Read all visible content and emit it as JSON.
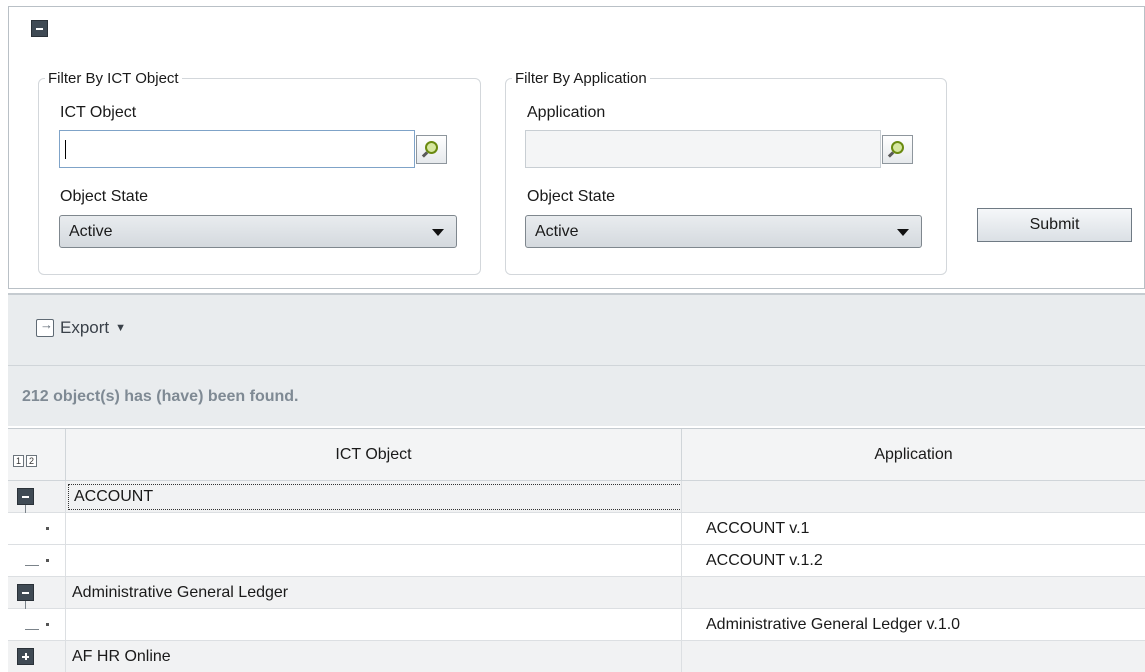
{
  "filters": {
    "ict_group": {
      "legend": "Filter By ICT Object",
      "field_label": "ICT Object",
      "field_value": "",
      "state_label": "Object State",
      "state_value": "Active"
    },
    "app_group": {
      "legend": "Filter By Application",
      "field_label": "Application",
      "field_value": "",
      "state_label": "Object State",
      "state_value": "Active"
    },
    "submit_label": "Submit"
  },
  "toolbar": {
    "export_label": "Export",
    "dropdown_glyph": "▼"
  },
  "result": {
    "message": "212 object(s) has (have) been found."
  },
  "grid": {
    "level_buttons": [
      "1",
      "2"
    ],
    "columns": [
      "ICT Object",
      "Application"
    ],
    "rows": [
      {
        "type": "group",
        "ict": "ACCOUNT",
        "app": "",
        "expanded": true
      },
      {
        "type": "detail",
        "ict": "",
        "app": "ACCOUNT v.1"
      },
      {
        "type": "detail",
        "ict": "",
        "app": "ACCOUNT v.1.2"
      },
      {
        "type": "group",
        "ict": "Administrative General Ledger",
        "app": "",
        "expanded": true
      },
      {
        "type": "detail",
        "ict": "",
        "app": "Administrative General Ledger v.1.0"
      },
      {
        "type": "group",
        "ict": "AF HR Online",
        "app": "",
        "expanded": false
      }
    ]
  },
  "icons": {
    "collapse": "minus-square-icon",
    "lookup": "magnifier-icon",
    "export": "export-icon",
    "expand": "plus-square-icon"
  }
}
